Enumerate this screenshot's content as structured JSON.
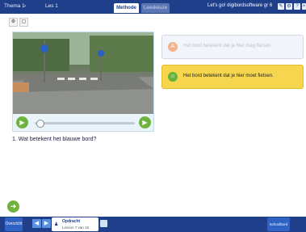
{
  "header": {
    "crumb1": "Thema 1",
    "crumb2": "Les 1",
    "tab_methode": "Methode",
    "tab_leeskeuze": "Leeskeuze",
    "brand": "Let's go! digibordsoftware gr 6",
    "icons": [
      "pen-icon",
      "gear-icon",
      "help-icon",
      "close-icon"
    ]
  },
  "toolbar": {
    "gear": "⚙",
    "doc": "▢"
  },
  "question": {
    "text": "1. Wat betekent het blauwe bord?"
  },
  "answers": [
    {
      "letter": "A",
      "text": "Het bord betekent dat je hier mag fietsen."
    },
    {
      "letter": "☺",
      "text": "Het bord betekent dat je hier moet fietsen."
    }
  ],
  "video": {
    "play": "▶",
    "next": "▶",
    "progress": 0.05
  },
  "next_button": "➜",
  "bottom": {
    "home_label": "Overzicht",
    "prev": "◀",
    "next": "▶",
    "opdracht_title": "Opdracht",
    "opdracht_sub": "Lesson 7 van 15",
    "right_label": "Schoolbord"
  },
  "colors": {
    "bar": "#1f3f8a",
    "green": "#6fb23d",
    "yellow": "#f6d64e"
  }
}
